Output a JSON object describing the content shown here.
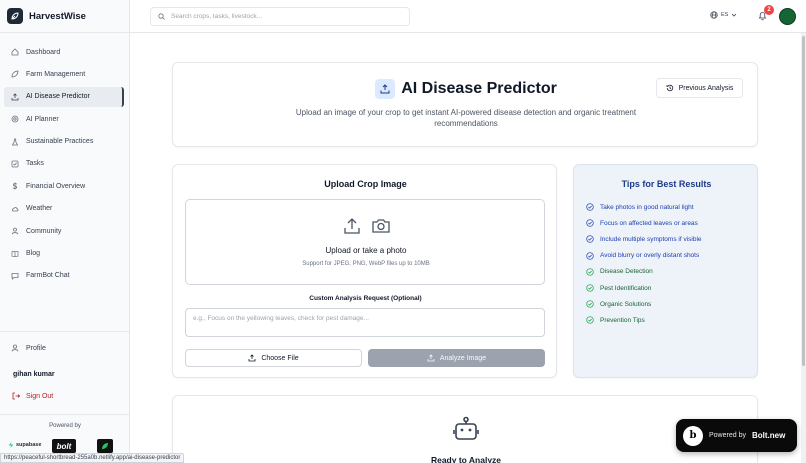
{
  "app": {
    "name": "HarvestWise"
  },
  "sidebar": {
    "items": [
      {
        "label": "Dashboard",
        "icon": "home-icon",
        "active": false
      },
      {
        "label": "Farm Management",
        "icon": "leaf-icon",
        "active": false
      },
      {
        "label": "AI Disease Predictor",
        "icon": "upload-icon",
        "active": true
      },
      {
        "label": "AI Planner",
        "icon": "target-icon",
        "active": false
      },
      {
        "label": "Sustainable Practices",
        "icon": "flask-icon",
        "active": false
      },
      {
        "label": "Tasks",
        "icon": "checklist-icon",
        "active": false
      },
      {
        "label": "Financial Overview",
        "icon": "dollar-icon",
        "active": false
      },
      {
        "label": "Weather",
        "icon": "cloud-icon",
        "active": false
      },
      {
        "label": "Community",
        "icon": "users-icon",
        "active": false
      },
      {
        "label": "Blog",
        "icon": "book-icon",
        "active": false
      },
      {
        "label": "FarmBot Chat",
        "icon": "chat-icon",
        "active": false
      }
    ],
    "profile_label": "Profile",
    "username": "gihan kumar",
    "signout_label": "Sign Out",
    "powered_by": "Powered by",
    "partners": {
      "supabase": "supabase",
      "bolt": "bolt"
    }
  },
  "header": {
    "search_placeholder": "Search crops, tasks, livestock...",
    "language": "ES",
    "notification_count": "2"
  },
  "hero": {
    "title": "AI Disease Predictor",
    "subtitle": "Upload an image of your crop to get instant AI-powered disease detection and organic treatment recommendations",
    "previous_button": "Previous Analysis"
  },
  "upload": {
    "title": "Upload Crop Image",
    "dropzone_title": "Upload or take a photo",
    "dropzone_sub": "Support for JPEG, PNG, WebP files up to 10MB",
    "custom_label": "Custom Analysis Request (Optional)",
    "custom_placeholder": "e.g., Focus on the yellowing leaves, check for pest damage...",
    "choose_button": "Choose File",
    "analyze_button": "Analyze Image"
  },
  "tips": {
    "title": "Tips for Best Results",
    "items": [
      {
        "text": "Take photos in good natural light",
        "color": "blue"
      },
      {
        "text": "Focus on affected leaves or areas",
        "color": "blue"
      },
      {
        "text": "Include multiple symptoms if visible",
        "color": "blue"
      },
      {
        "text": "Avoid blurry or overly distant shots",
        "color": "blue"
      },
      {
        "text": "Disease Detection",
        "color": "green"
      },
      {
        "text": "Pest Identification",
        "color": "green"
      },
      {
        "text": "Organic Solutions",
        "color": "green"
      },
      {
        "text": "Prevention Tips",
        "color": "green"
      }
    ]
  },
  "ready": {
    "title": "Ready to Analyze"
  },
  "bolt_badge": {
    "label": "Powered by",
    "brand": "Bolt.new",
    "letter": "b"
  },
  "status_url": "https://peaceful-shortbread-255a0b.netlify.app/ai-disease-predictor",
  "colors": {
    "accent_blue": "#1e40af",
    "accent_green": "#166534",
    "signout_red": "#b91c1c",
    "button_disabled": "#9ca3af"
  }
}
